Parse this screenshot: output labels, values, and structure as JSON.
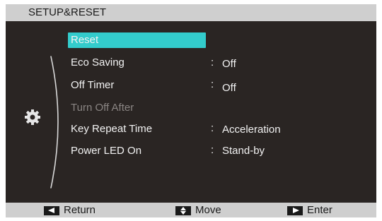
{
  "header": {
    "title": "SETUP&RESET"
  },
  "menu": {
    "items": [
      {
        "label": "Reset",
        "value": ""
      },
      {
        "label": "Eco Saving",
        "value": "Off"
      },
      {
        "label": "Off Timer",
        "value": "Off"
      },
      {
        "label": "Turn Off After",
        "value": ""
      },
      {
        "label": "Key Repeat Time",
        "value": "Acceleration"
      },
      {
        "label": "Power LED On",
        "value": "Stand-by"
      }
    ],
    "separator": ":"
  },
  "footer": {
    "return_label": "Return",
    "move_label": "Move",
    "enter_label": "Enter"
  },
  "colors": {
    "panel_bg": "#2a2523",
    "bar_bg": "#cfcfcf",
    "selection": "#33cccc",
    "text": "#f2f2f2",
    "disabled_text": "#8a8583"
  },
  "icons": {
    "category": "gear-icon",
    "return": "arrow-left-icon",
    "move": "arrow-up-down-icon",
    "enter": "arrow-right-icon"
  }
}
